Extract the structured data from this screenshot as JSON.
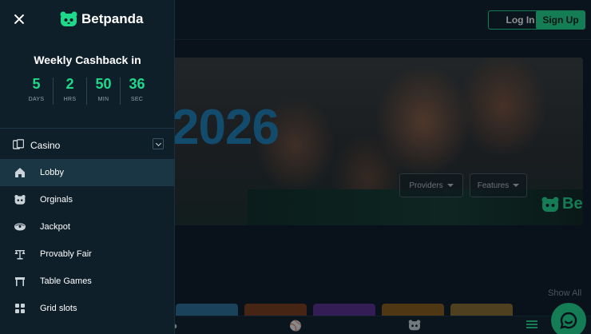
{
  "header": {
    "brand": "Betpanda",
    "login_label": "Log In",
    "signup_label": "Sign Up"
  },
  "colors": {
    "accent": "#1fd98a",
    "drawer_bg": "#0f1f2a",
    "active_item_bg": "#1a3543",
    "hero_year": "#1c7fb5"
  },
  "hero": {
    "year_text": "2026",
    "logo_text": "Be",
    "providers_label": "Providers",
    "features_label": "Features"
  },
  "games": {
    "show_all_label": "Show All"
  },
  "drawer": {
    "cashback_title": "Weekly Cashback in",
    "countdown": [
      {
        "value": "5",
        "unit": "DAYS"
      },
      {
        "value": "2",
        "unit": "HRS"
      },
      {
        "value": "50",
        "unit": "MIN"
      },
      {
        "value": "36",
        "unit": "SEC"
      }
    ],
    "section": {
      "label": "Casino",
      "icon": "casino-icon"
    },
    "items": [
      {
        "label": "Lobby",
        "icon": "home-icon",
        "active": true
      },
      {
        "label": "Orginals",
        "icon": "panda-icon",
        "active": false
      },
      {
        "label": "Jackpot",
        "icon": "jackpot-icon",
        "active": false
      },
      {
        "label": "Provably Fair",
        "icon": "scales-icon",
        "active": false
      },
      {
        "label": "Table Games",
        "icon": "table-icon",
        "active": false
      },
      {
        "label": "Grid slots",
        "icon": "grid-icon",
        "active": false
      }
    ]
  }
}
